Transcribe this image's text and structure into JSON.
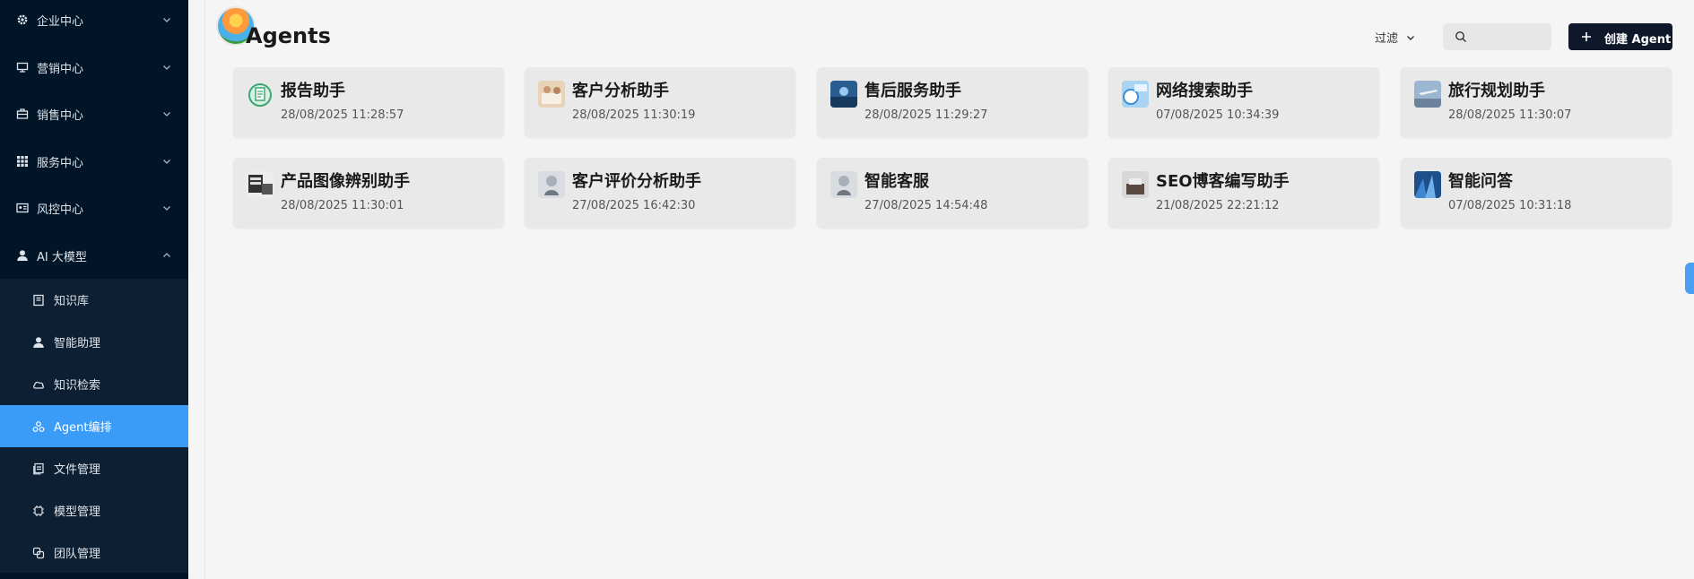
{
  "sidebar": {
    "items": [
      {
        "label": "企业中心",
        "icon": "gear-icon"
      },
      {
        "label": "营销中心",
        "icon": "monitor-icon"
      },
      {
        "label": "销售中心",
        "icon": "briefcase-icon"
      },
      {
        "label": "服务中心",
        "icon": "grid-icon"
      },
      {
        "label": "风控中心",
        "icon": "id-card-icon"
      },
      {
        "label": "AI 大模型",
        "icon": "user-icon"
      }
    ],
    "sub_items": [
      {
        "label": "知识库",
        "icon": "book-icon"
      },
      {
        "label": "智能助理",
        "icon": "user-icon"
      },
      {
        "label": "知识检索",
        "icon": "cloud-icon"
      },
      {
        "label": "Agent编排",
        "icon": "agent-icon",
        "active": true
      },
      {
        "label": "文件管理",
        "icon": "files-icon"
      },
      {
        "label": "模型管理",
        "icon": "chip-icon"
      },
      {
        "label": "团队管理",
        "icon": "team-icon"
      }
    ],
    "active_color": "#3b9cf7"
  },
  "header": {
    "title": "Agents",
    "filter_label": "过滤",
    "search_placeholder": "",
    "create_label": "创建 Agent"
  },
  "cards": [
    {
      "name": "报告助手",
      "time": "28/08/2025 11:28:57"
    },
    {
      "name": "客户分析助手",
      "time": "28/08/2025 11:30:19"
    },
    {
      "name": "售后服务助手",
      "time": "28/08/2025 11:29:27"
    },
    {
      "name": "网络搜索助手",
      "time": "07/08/2025 10:34:39"
    },
    {
      "name": "旅行规划助手",
      "time": "28/08/2025 11:30:07"
    },
    {
      "name": "产品图像辨别助手",
      "time": "28/08/2025 11:30:01"
    },
    {
      "name": "客户评价分析助手",
      "time": "27/08/2025 16:42:30"
    },
    {
      "name": "智能客服",
      "time": "27/08/2025 14:54:48"
    },
    {
      "name": "SEO博客编写助手",
      "time": "21/08/2025 22:21:12"
    },
    {
      "name": "智能问答",
      "time": "07/08/2025 10:31:18"
    }
  ]
}
